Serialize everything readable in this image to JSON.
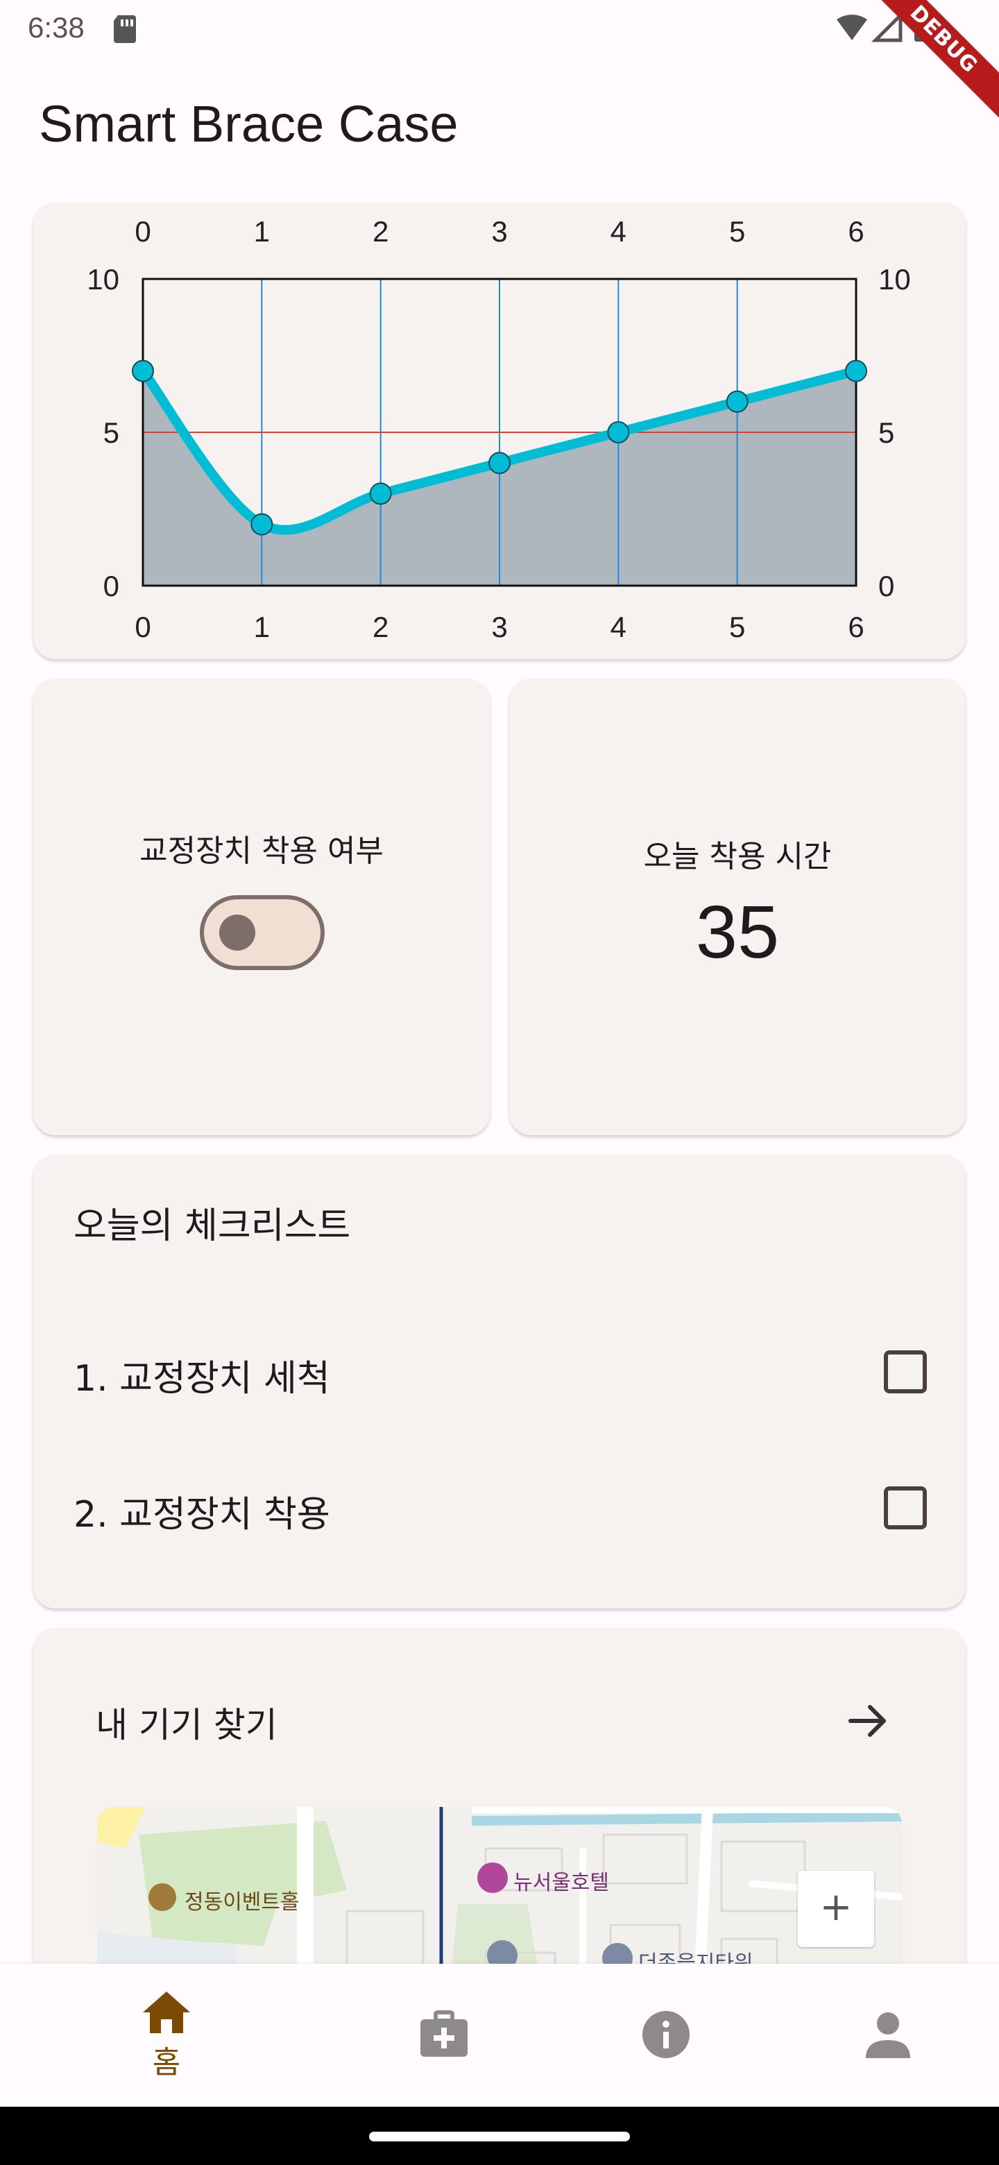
{
  "status_bar": {
    "time": "6:38"
  },
  "debug_banner": "DEBUG",
  "app_title": "Smart Brace Case",
  "chart_data": {
    "type": "line",
    "x": [
      0,
      1,
      2,
      3,
      4,
      5,
      6
    ],
    "values": [
      7,
      2,
      3,
      4,
      5,
      6,
      7
    ],
    "xlim": [
      0,
      6
    ],
    "ylim": [
      0,
      10
    ],
    "y_ticks": [
      "0",
      "5",
      "10"
    ],
    "x_ticks": [
      "0",
      "1",
      "2",
      "3",
      "4",
      "5",
      "6"
    ],
    "reference_line_y": 5,
    "curved": true,
    "filled_area": true,
    "colors": {
      "line": "#00bcd4",
      "fill": "#aeb7bd",
      "grid": "#1e88e5",
      "reference": "#e53935"
    }
  },
  "wear_card": {
    "label": "교정장치 착용 여부",
    "toggle_on": false
  },
  "time_card": {
    "label": "오늘 착용 시간",
    "value": "35"
  },
  "checklist": {
    "title": "오늘의 체크리스트",
    "items": [
      {
        "label": "1. 교정장치 세척",
        "checked": false
      },
      {
        "label": "2. 교정장치 착용",
        "checked": false
      }
    ]
  },
  "finder": {
    "title": "내 기기 찾기",
    "map_labels": {
      "event_hall": "정동이벤트홀",
      "hotel": "뉴서울호텔",
      "tower": "더존을지타워"
    },
    "zoom_in": "+"
  },
  "bottom_nav": {
    "items": [
      {
        "label": "홈",
        "icon": "home-icon",
        "active": true
      },
      {
        "label": "",
        "icon": "medical-kit-icon",
        "active": false
      },
      {
        "label": "",
        "icon": "info-icon",
        "active": false
      },
      {
        "label": "",
        "icon": "person-icon",
        "active": false
      }
    ],
    "active_color": "#7a4a00",
    "inactive_color": "#8c8a8c"
  }
}
